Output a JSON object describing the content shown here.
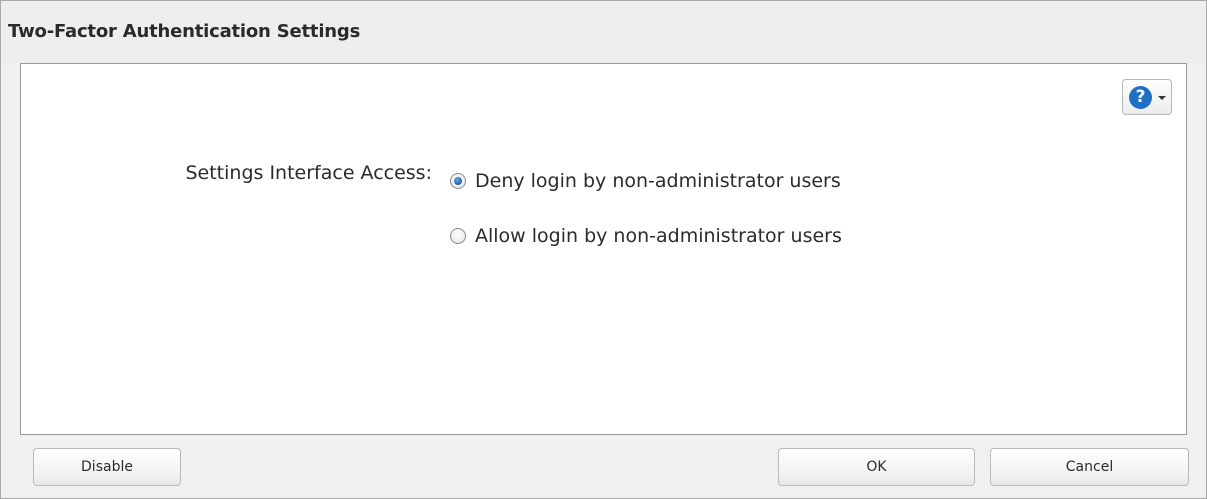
{
  "dialog": {
    "title": "Two-Factor Authentication Settings"
  },
  "help": {
    "glyph": "?",
    "accent": "#1f6fc4"
  },
  "form": {
    "label": "Settings Interface Access:",
    "options": [
      {
        "label": "Deny login by non-administrator users",
        "selected": true
      },
      {
        "label": "Allow login by non-administrator users",
        "selected": false
      }
    ]
  },
  "footer": {
    "disable_label": "Disable",
    "ok_label": "OK",
    "cancel_label": "Cancel"
  }
}
